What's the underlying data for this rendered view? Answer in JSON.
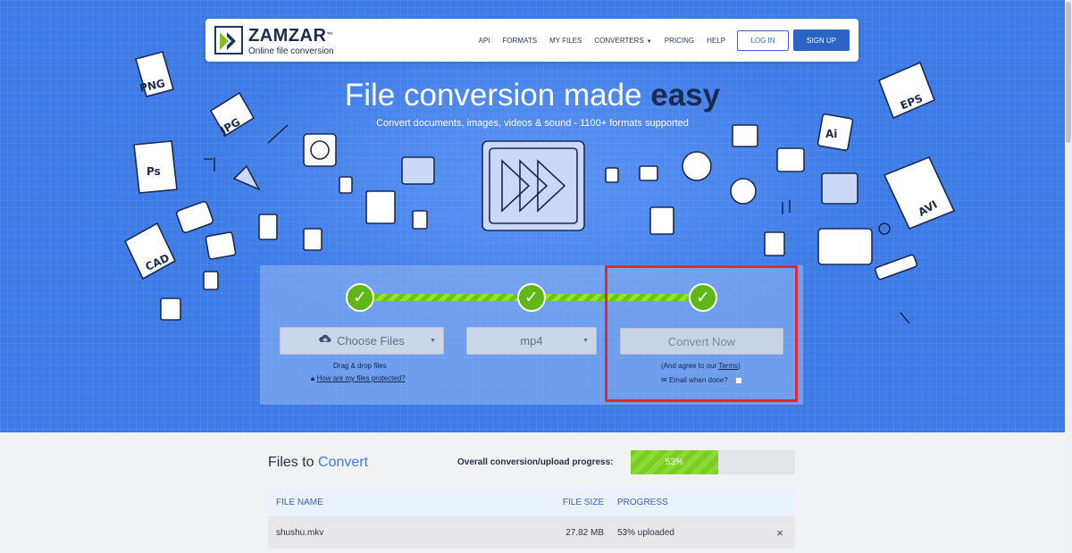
{
  "brand": {
    "name": "ZAMZAR",
    "tm": "™",
    "tagline": "Online file conversion"
  },
  "nav": {
    "links": [
      "API",
      "FORMATS",
      "MY FILES",
      "CONVERTERS",
      "PRICING",
      "HELP"
    ],
    "login": "LOG IN",
    "signup": "SIGN UP"
  },
  "hero": {
    "headline": "File conversion made",
    "headline_emph": "easy",
    "subhead": "Convert documents, images, videos & sound - 1100+ formats supported"
  },
  "converter": {
    "steps_done": [
      true,
      true,
      true
    ],
    "step_glyph": "✓",
    "choose_files": "Choose Files",
    "drag_drop": "Drag & drop files",
    "protected_link": "How are my files protected?",
    "format": "mp4",
    "convert_now": "Convert Now",
    "agree_prefix": "(And agree to our",
    "terms": "Terms",
    "agree_suffix": ")",
    "email_label": "Email when done?"
  },
  "files": {
    "title_a": "Files to",
    "title_b": "Convert",
    "progress_label": "Overall conversion/upload progress:",
    "progress_text": "53%",
    "progress_value": 0.53,
    "columns": [
      "FILE NAME",
      "FILE SIZE",
      "PROGRESS"
    ],
    "rows": [
      {
        "name": "shushu.mkv",
        "size": "27.82 MB",
        "progress": "53% uploaded",
        "remove": "×"
      }
    ]
  },
  "icons": [
    "logo-icon",
    "cloud-upload-icon",
    "lock-icon",
    "envelope-icon",
    "close-icon"
  ],
  "colors": {
    "accent": "#2d62c6",
    "hero": "#3c7ae6",
    "green": "#5fb617",
    "highlight": "#e5272f"
  }
}
